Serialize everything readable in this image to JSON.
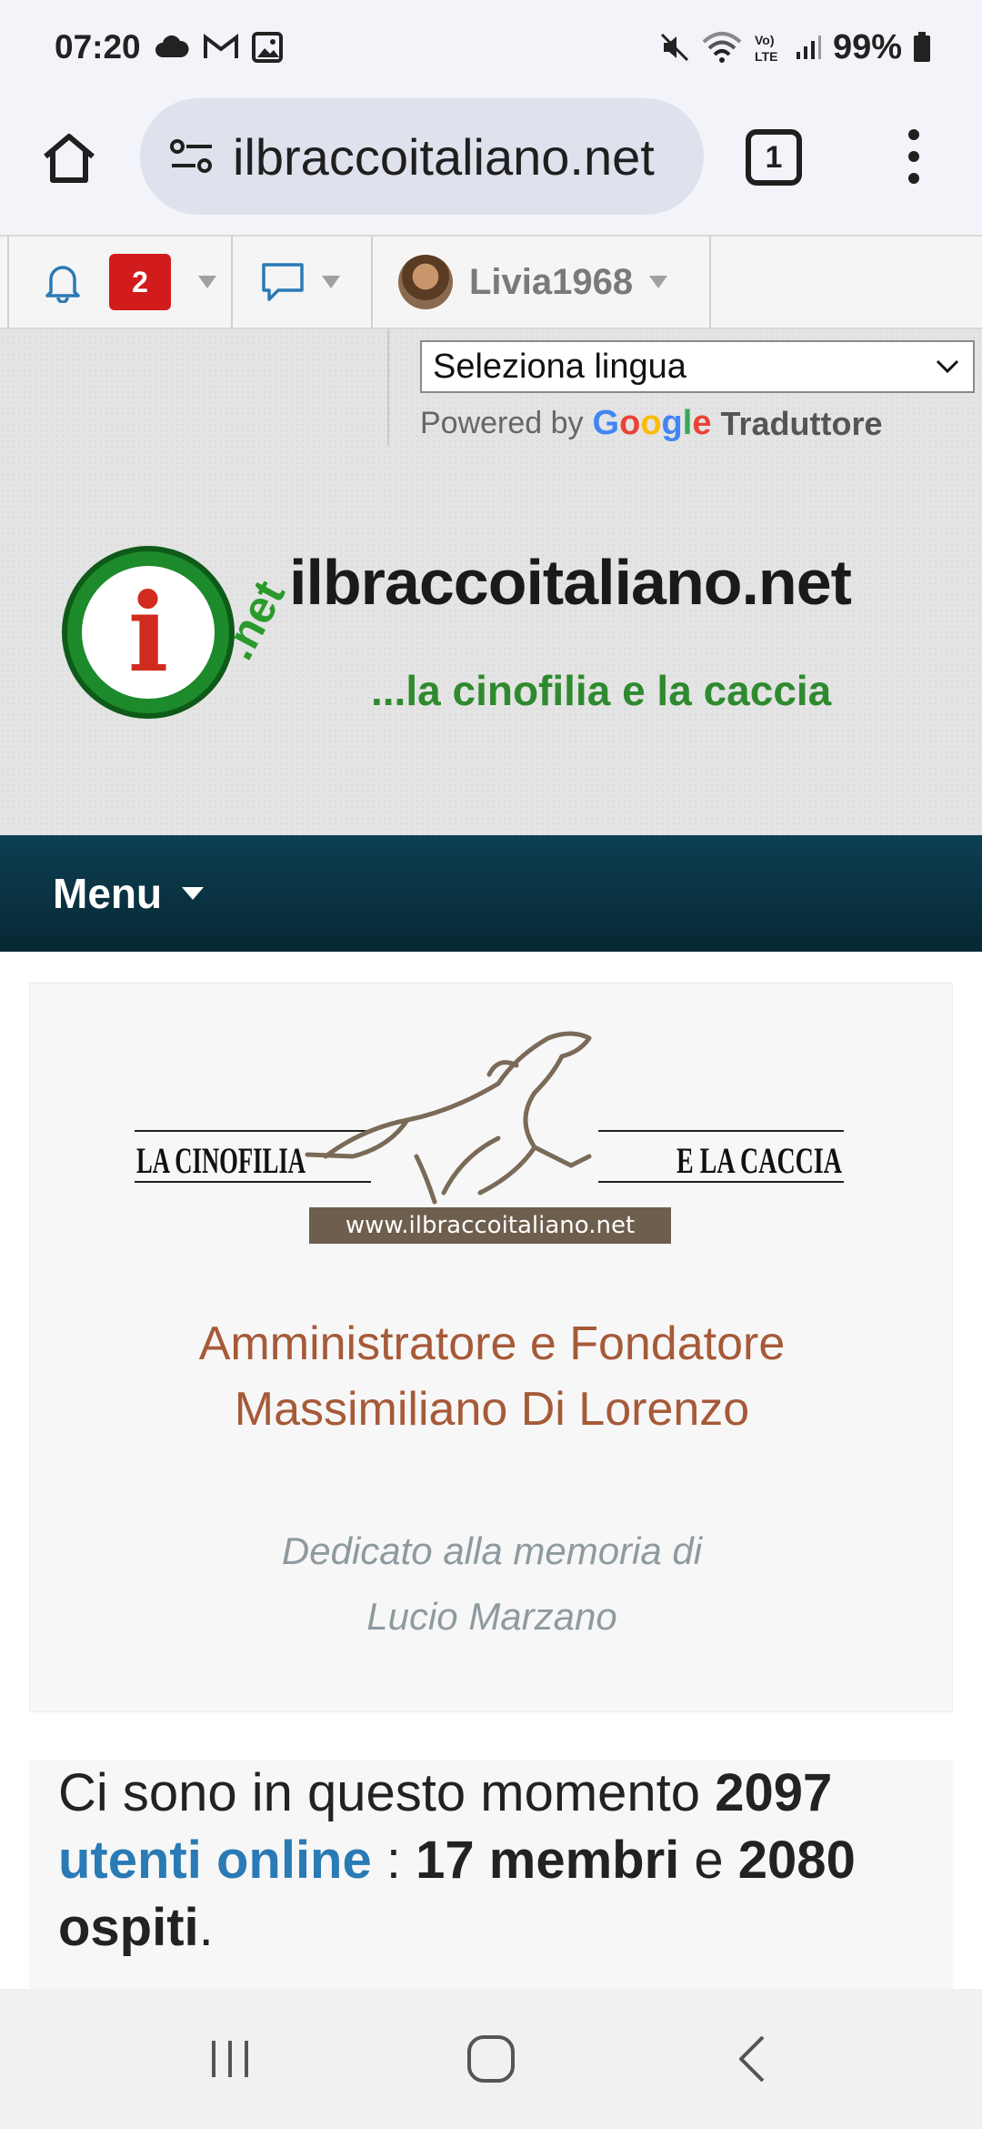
{
  "status_bar": {
    "time": "07:20",
    "battery": "99%"
  },
  "browser": {
    "url": "ilbraccoitaliano.net",
    "tab_count": "1"
  },
  "forum_bar": {
    "alerts_count": "2",
    "username": "Livia1968"
  },
  "translate": {
    "select_value": "Seleziona lingua",
    "powered_by": "Powered by",
    "google": "Google",
    "translator": "Traduttore"
  },
  "header": {
    "site_title": "ilbraccoitaliano.net",
    "tagline": "...la cinofilia e la caccia",
    "logo_letter": "i",
    "logo_suffix": ".net"
  },
  "menu": {
    "label": "Menu"
  },
  "banner": {
    "left_text": "LA CINOFILIA",
    "right_text": "E LA CACCIA",
    "url": "www.ilbraccoitaliano.net"
  },
  "admin": {
    "line1": "Amministratore e Fondatore",
    "line2": "Massimiliano Di Lorenzo"
  },
  "dedication": {
    "line1": "Dedicato alla memoria di",
    "line2": "Lucio Marzano"
  },
  "online": {
    "prefix": "Ci sono in questo momento",
    "total": "2097",
    "link": "utenti online",
    "sep": ":",
    "members": "17 membri",
    "and": "e",
    "guests": "2080 ospiti",
    "end": "."
  },
  "colors": {
    "menu_bg": "#0a3444",
    "badge_red": "#d21c1c",
    "admin_text": "#a65a38",
    "link_blue": "#2a7ab5"
  }
}
